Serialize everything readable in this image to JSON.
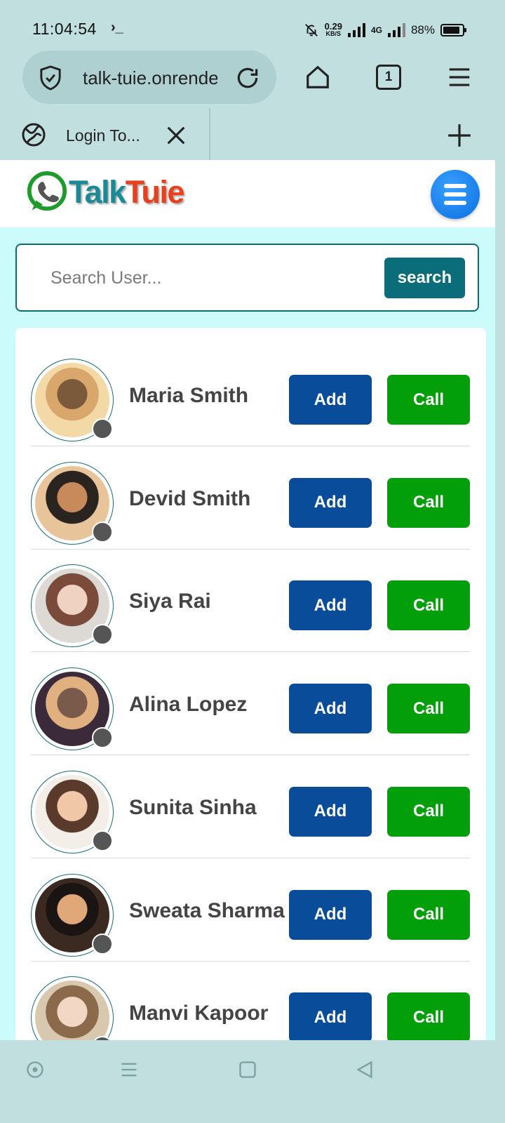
{
  "status_bar": {
    "time": "11:04:54",
    "terminal_glyph": "›_",
    "speed_value": "0.29",
    "speed_unit": "KB/S",
    "network": "4G",
    "battery": "88%",
    "battery_level": 0.88
  },
  "browser": {
    "url": "talk-tuie.onrender.com",
    "tab_count": "1",
    "tab_title": "Login To..."
  },
  "site": {
    "logo_part1": "Talk",
    "logo_part2": "Tuie",
    "brand_colors": {
      "talk": "#1a8a96",
      "tuie": "#e8401c",
      "menu": "#0a6fe0"
    }
  },
  "search": {
    "placeholder": "Search User...",
    "value": "",
    "button_label": "search"
  },
  "users": [
    {
      "name": "Maria Smith",
      "add_label": "Add",
      "call_label": "Call"
    },
    {
      "name": "Devid Smith",
      "add_label": "Add",
      "call_label": "Call"
    },
    {
      "name": "Siya Rai",
      "add_label": "Add",
      "call_label": "Call"
    },
    {
      "name": "Alina Lopez",
      "add_label": "Add",
      "call_label": "Call"
    },
    {
      "name": "Sunita Sinha",
      "add_label": "Add",
      "call_label": "Call"
    },
    {
      "name": "Sweata Sharma",
      "add_label": "Add",
      "call_label": "Call"
    },
    {
      "name": "Manvi Kapoor",
      "add_label": "Add",
      "call_label": "Call"
    }
  ],
  "colors": {
    "add_button": "#094d9a",
    "call_button": "#029f0a",
    "search_button": "#0b6c7a",
    "offline_dot": "#555555"
  }
}
